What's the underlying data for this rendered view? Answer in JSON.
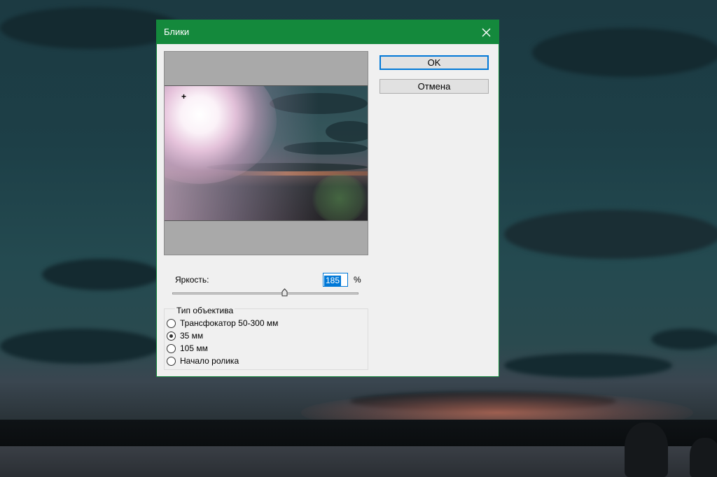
{
  "dialog": {
    "title": "Блики",
    "close_icon": "close-icon",
    "ok_label": "OK",
    "cancel_label": "Отмена",
    "crosshair_glyph": "+",
    "brightness": {
      "label": "Яркость:",
      "value": "185",
      "unit": "%"
    },
    "lens_group": {
      "title": "Тип объектива",
      "options": [
        {
          "label": "Трансфокатор 50-300 мм",
          "selected": false
        },
        {
          "label": "35 мм",
          "selected": true
        },
        {
          "label": "105 мм",
          "selected": false
        },
        {
          "label": "Начало ролика",
          "selected": false
        }
      ]
    }
  },
  "colors": {
    "titlebar": "#14893c",
    "dialog_bg": "#f0f0f0",
    "focus_accent": "#0078d7"
  }
}
